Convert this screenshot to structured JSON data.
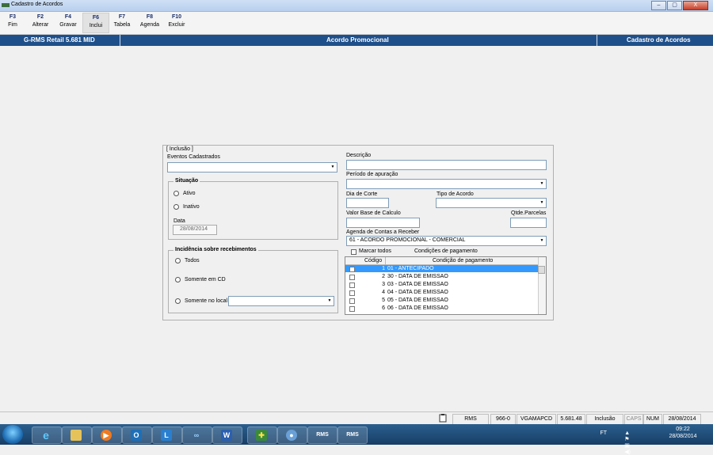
{
  "window": {
    "title": "Cadastro de Acordos",
    "min": "–",
    "max": "▢",
    "close": "X"
  },
  "toolbar": [
    {
      "key": "F3",
      "label": "Fim"
    },
    {
      "key": "F2",
      "label": "Alterar"
    },
    {
      "key": "F4",
      "label": "Gravar"
    },
    {
      "key": "F6",
      "label": "Inclui"
    },
    {
      "key": "F7",
      "label": "Tabela"
    },
    {
      "key": "F8",
      "label": "Agenda"
    },
    {
      "key": "F10",
      "label": "Excluir"
    }
  ],
  "header": {
    "left": "G-RMS Retail 5.681 MID",
    "center": "Acordo Promocional",
    "right": "Cadastro de Acordos"
  },
  "form": {
    "mode": "[ Inclusão ]",
    "eventos_label": "Eventos Cadastrados",
    "eventos_value": "",
    "situacao": {
      "title": "Situação",
      "ativo": "Ativo",
      "inativo": "Inativo",
      "data_label": "Data",
      "data_value": "28/08/2014"
    },
    "incidencia": {
      "title": "Incidência sobre recebimentos",
      "todos": "Todos",
      "somente_cd": "Somente em CD",
      "somente_local": "Somente no local",
      "local_value": ""
    },
    "descricao_label": "Descrição",
    "periodo_label": "Período de apuração",
    "dia_corte_label": "Dia de Corte",
    "tipo_acordo_label": "Tipo de Acordo",
    "valor_base_label": "Valor Base de Calculo",
    "qtde_parcelas_label": "Qtde.Parcelas",
    "agenda_label": "Agenda de Contas a Receber",
    "agenda_value": "61 - ACORDO PROMOCIONAL - COMERCIAL",
    "marcar_todos": "Marcar todos",
    "condicoes_label": "Condições de pagamento"
  },
  "grid": {
    "col_codigo": "Código",
    "col_condicao": "Condição de pagamento",
    "rows": [
      {
        "codigo": "1",
        "condicao": "01 - ANTECIPADO"
      },
      {
        "codigo": "2",
        "condicao": "30 - DATA DE EMISSAO"
      },
      {
        "codigo": "3",
        "condicao": "03 - DATA DE EMISSAO"
      },
      {
        "codigo": "4",
        "condicao": "04 - DATA DE EMISSAO"
      },
      {
        "codigo": "5",
        "condicao": "05 - DATA DE EMISSAO"
      },
      {
        "codigo": "6",
        "condicao": "06 - DATA DE EMISSAO"
      }
    ]
  },
  "statusbar": [
    "RMS",
    "966-0",
    "VGAMAPCD",
    "5.681.48",
    "Inclusão",
    "CAPS",
    "NUM",
    "28/08/2014"
  ],
  "taskbar": {
    "apps": [
      "ie-icon",
      "explorer-icon",
      "media-icon",
      "outlook-icon",
      "lync-icon",
      "sharing-icon",
      "word-icon",
      "app-icon",
      "app2-icon",
      "rms-icon",
      "rms-icon-2"
    ],
    "rms_label": "RMS",
    "tray_lang": "FT",
    "time": "09:22",
    "date": "28/08/2014"
  }
}
